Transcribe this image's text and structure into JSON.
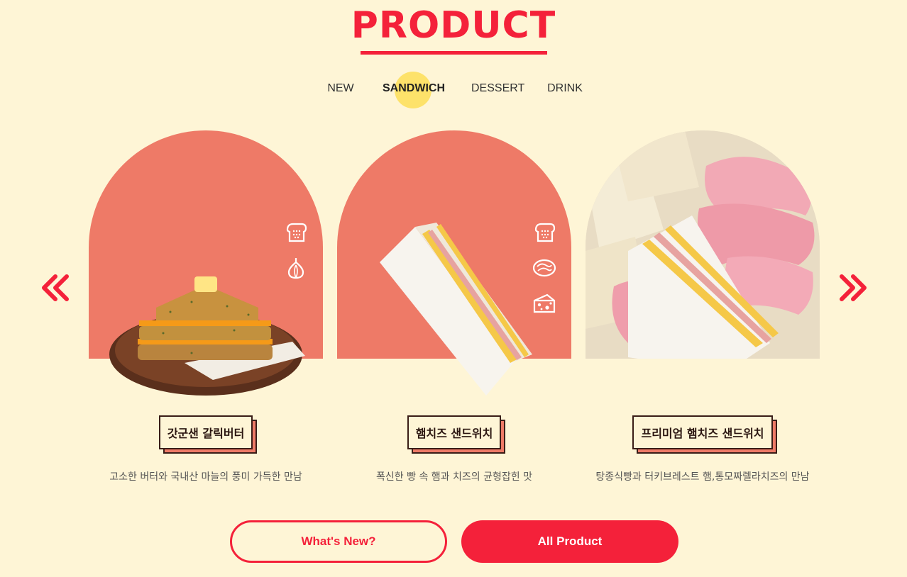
{
  "section": {
    "title": "PRODUCT"
  },
  "tabs": [
    "NEW",
    "SANDWICH",
    "DESSERT",
    "DRINK"
  ],
  "active_tab": "SANDWICH",
  "products": [
    {
      "name": "갓군샌 갈릭버터",
      "description": "고소한 버터와 국내산 마늘의 풍미 가득한 만남",
      "ingredients": [
        "bread-icon",
        "garlic-icon"
      ]
    },
    {
      "name": "햄치즈 샌드위치",
      "description": "폭신한 빵 속 햄과 치즈의 균형잡힌 맛",
      "ingredients": [
        "bread-icon",
        "ham-icon",
        "cheese-icon"
      ]
    },
    {
      "name": "프리미엄 햄치즈 샌드위치",
      "description": "탕종식빵과 터키브레스트 햄,통모짜렐라치즈의 만남",
      "ingredients": []
    }
  ],
  "buttons": {
    "whats_new": "What's New?",
    "all_product": "All Product"
  },
  "colors": {
    "accent": "#f4213a",
    "background": "#fef5d6",
    "arch": "#ee7a67",
    "tab_highlight": "#fde26a"
  }
}
